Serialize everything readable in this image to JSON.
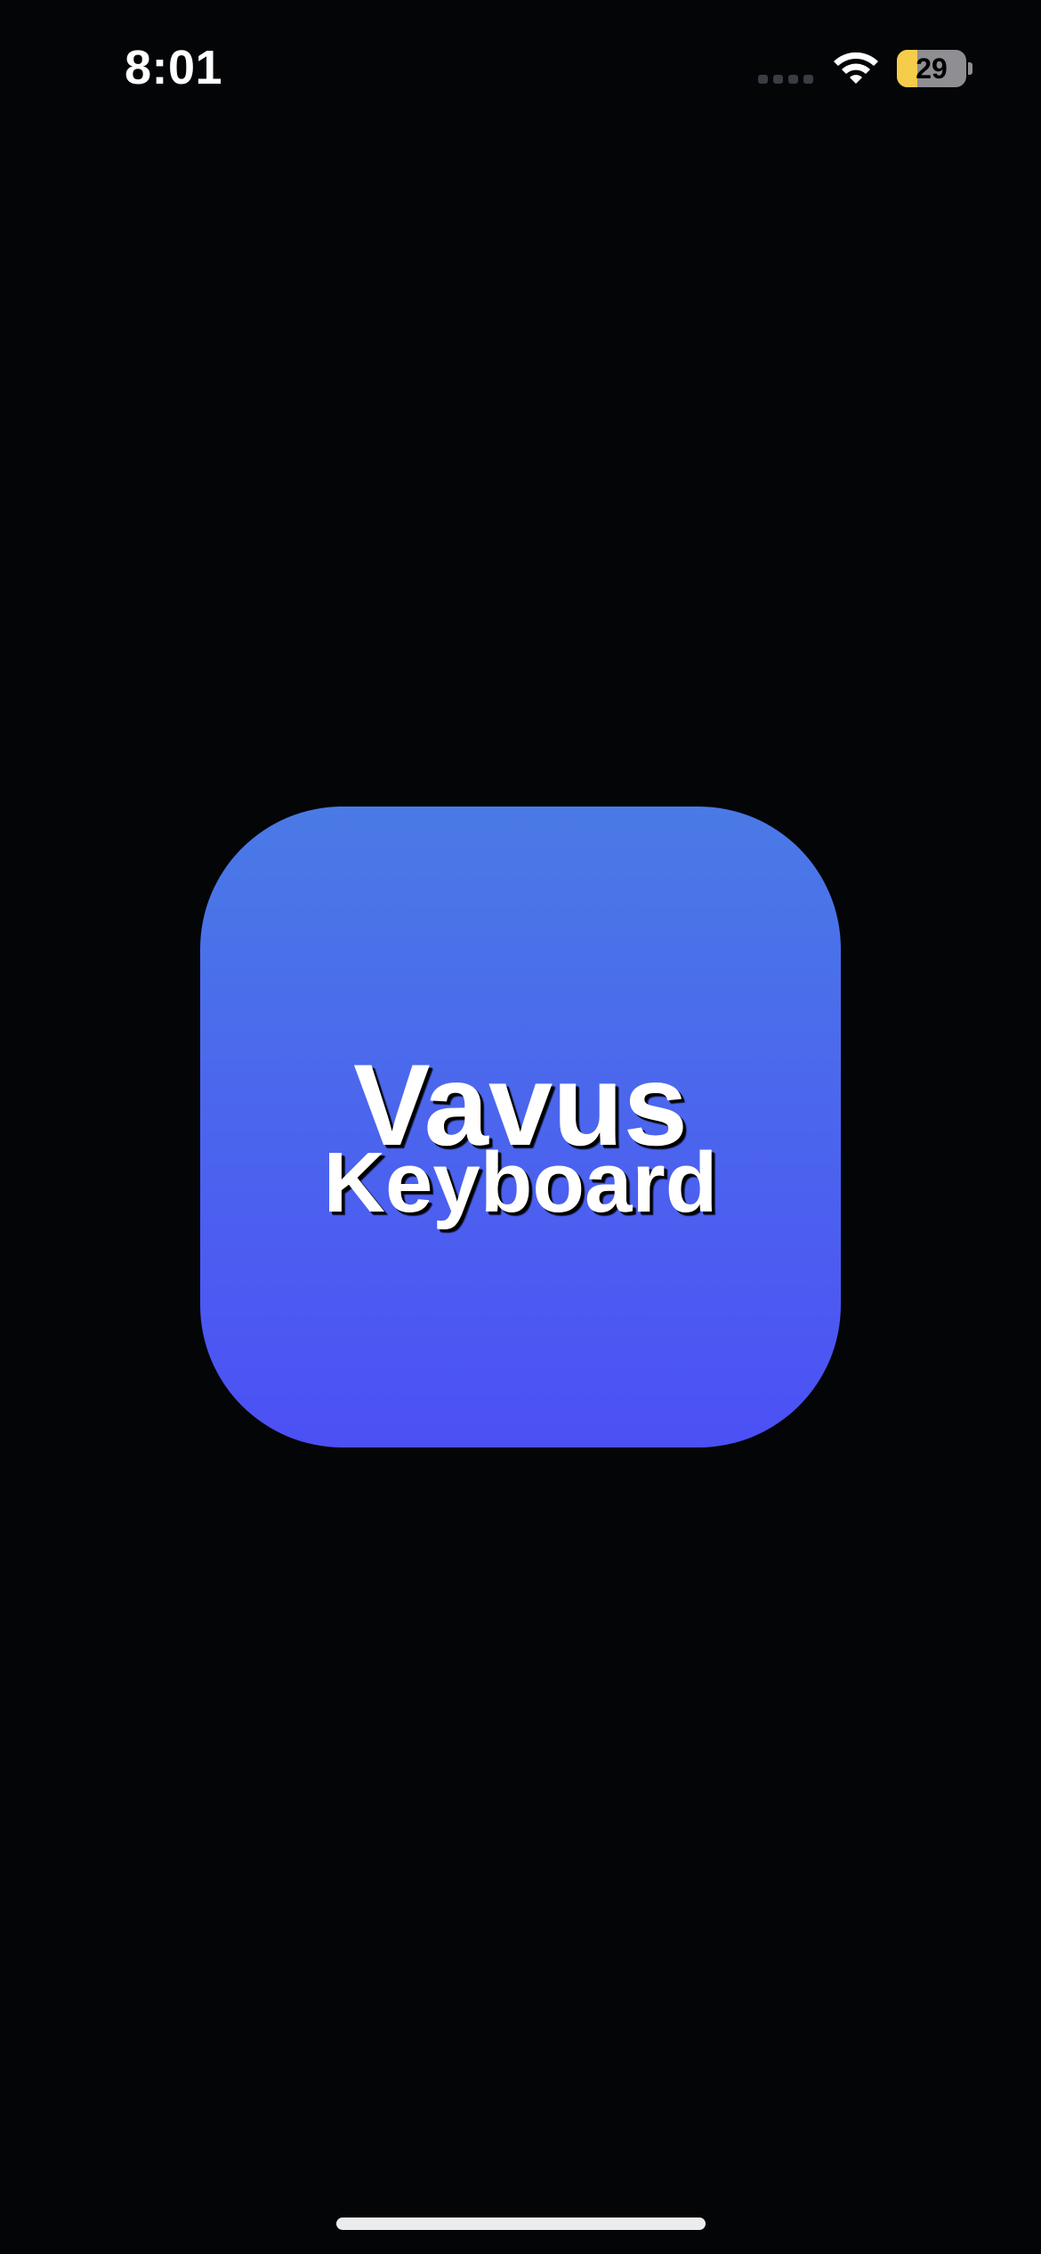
{
  "status_bar": {
    "time": "8:01",
    "battery_percent": "29",
    "battery_level": 0.29,
    "battery_color": "#f5cd4a",
    "wifi_icon": "wifi-icon",
    "signal_icon": "cellular-signal-icon"
  },
  "app_icon": {
    "title_line1": "Vavus",
    "title_line2": "Keyboard",
    "gradient_top": "#4a7ae6",
    "gradient_bottom": "#4c50f5"
  },
  "home_indicator": {
    "icon": "home-indicator"
  }
}
